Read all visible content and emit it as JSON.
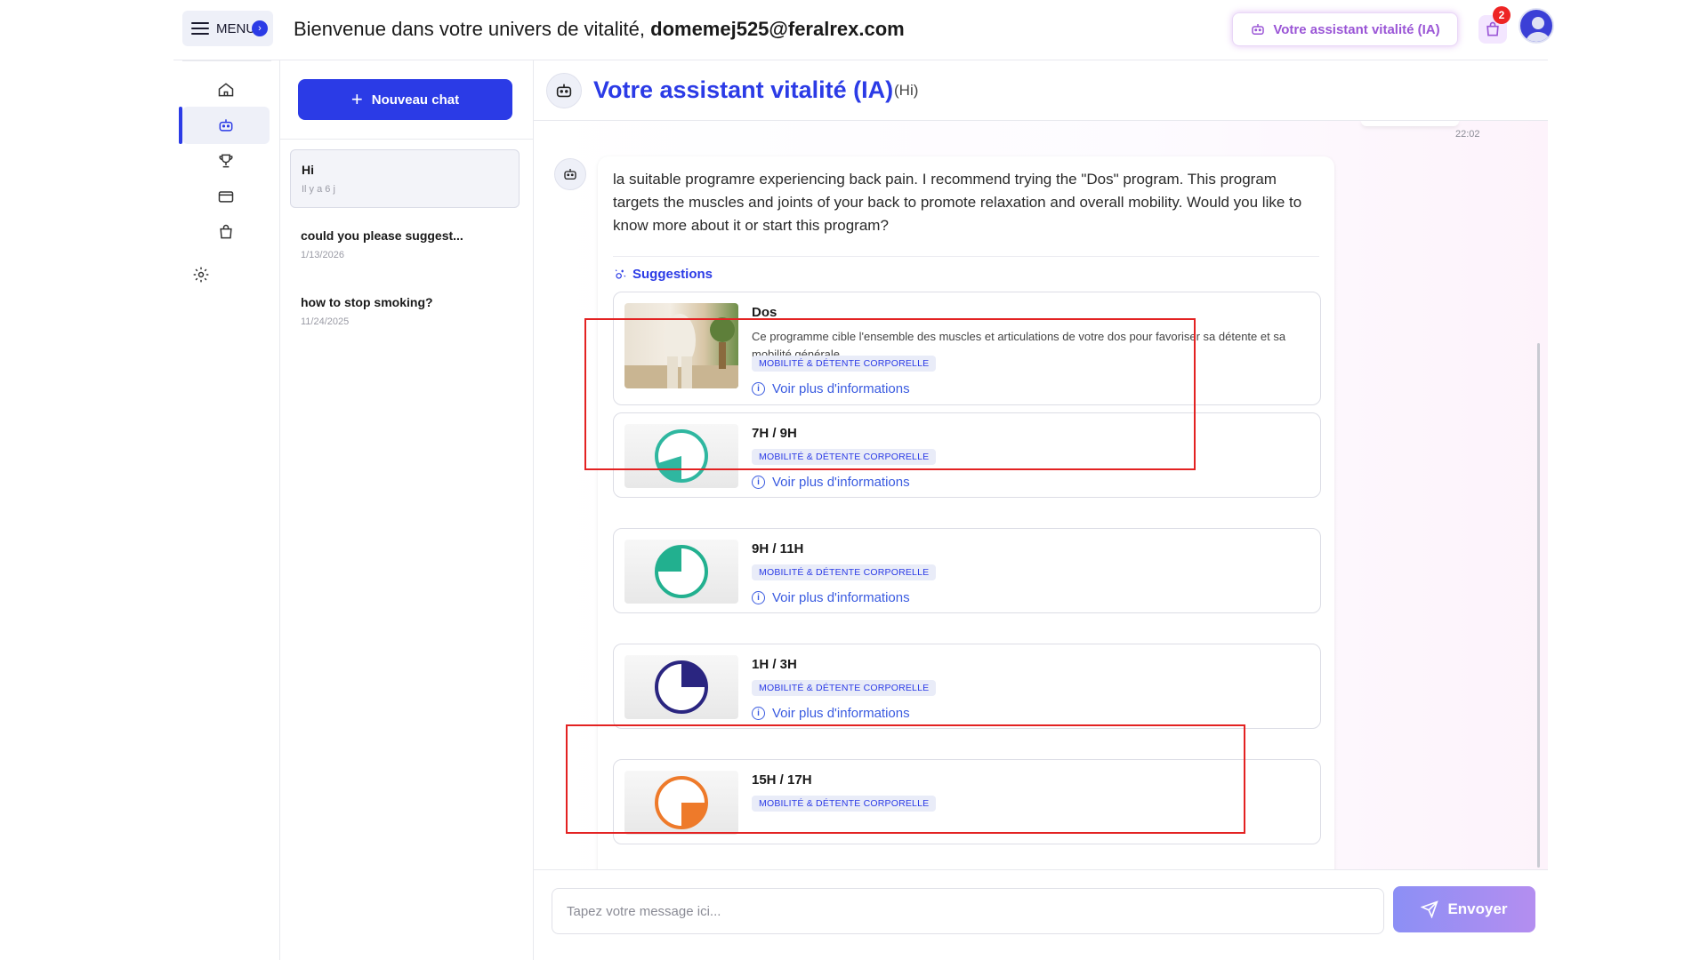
{
  "header": {
    "menu_label": "MENU",
    "welcome_prefix": "Bienvenue dans votre univers de vitalité, ",
    "user_email": "domemej525@feralrex.com",
    "assistant_button": "Votre assistant vitalité (IA)",
    "cart_count": "2"
  },
  "sidebar": {
    "items": [
      {
        "icon": "home-icon"
      },
      {
        "icon": "robot-icon",
        "active": true
      },
      {
        "icon": "trophy-icon"
      },
      {
        "icon": "card-icon"
      },
      {
        "icon": "bag-icon"
      },
      {
        "icon": "gear-icon"
      }
    ]
  },
  "chatlist": {
    "new_chat_label": "Nouveau chat",
    "items": [
      {
        "title": "Hi",
        "date": "Il y a 6 j",
        "active": true
      },
      {
        "title": "could you please suggest...",
        "date": "1/13/2026"
      },
      {
        "title": "how to stop smoking?",
        "date": "11/24/2025"
      }
    ]
  },
  "main": {
    "title": "Votre assistant vitalité (IA)",
    "subtitle": "(Hi)",
    "previous_time": "22:02",
    "bot_message": "la suitable programre experiencing back pain. I recommend trying the \"Dos\" program. This program targets the muscles and joints of your back to promote relaxation and overall mobility. Would you like to know more about it or start this program?",
    "suggestions_label": "Suggestions",
    "more_label": "Voir plus d'informations",
    "cards": [
      {
        "title": "Dos",
        "description": "Ce programme cible l'ensemble des muscles et articulations de votre dos pour favoriser sa détente et sa mobilité générale.",
        "tag": "MOBILITÉ & DÉTENTE CORPORELLE",
        "thumb": "back-stretch-photo"
      },
      {
        "title": "7H / 9H",
        "tag": "MOBILITÉ & DÉTENTE CORPORELLE",
        "thumb": "clock-icon",
        "color": "#2fb7a0"
      },
      {
        "title": "9H / 11H",
        "tag": "MOBILITÉ & DÉTENTE CORPORELLE",
        "thumb": "clock-icon",
        "color": "#22b08f"
      },
      {
        "title": "1H / 3H",
        "tag": "MOBILITÉ & DÉTENTE CORPORELLE",
        "thumb": "clock-icon",
        "color": "#2a2580"
      },
      {
        "title": "15H / 17H",
        "tag": "MOBILITÉ & DÉTENTE CORPORELLE",
        "thumb": "clock-icon",
        "color": "#ee7a2a"
      }
    ]
  },
  "composer": {
    "placeholder": "Tapez votre message ici...",
    "send_label": "Envoyer"
  },
  "colors": {
    "primary": "#2b3be6",
    "highlight_box": "#e32222",
    "assistant_accent": "#9a55d6"
  }
}
